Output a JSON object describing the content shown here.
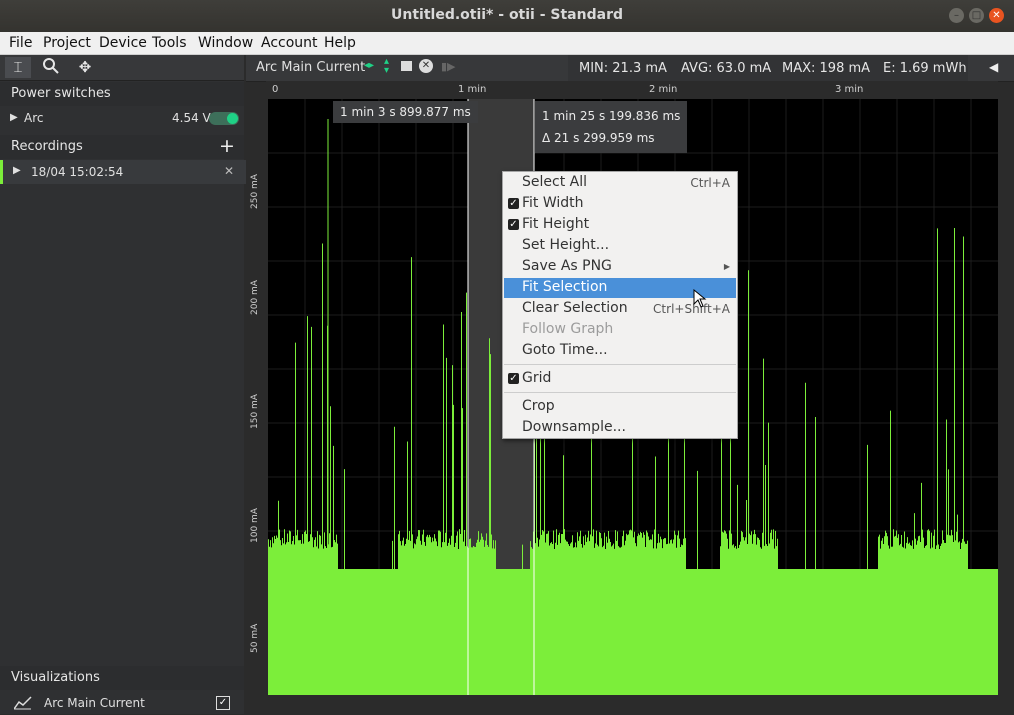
{
  "window": {
    "title": "Untitled.otii* - otii - Standard"
  },
  "menubar": [
    "File",
    "Project",
    "Device",
    "Tools",
    "Window",
    "Account",
    "Help"
  ],
  "sidebar": {
    "power_switches_title": "Power switches",
    "arc_label": "Arc",
    "arc_voltage": "4.54 V",
    "recordings_title": "Recordings",
    "recording_item": "18/04 15:02:54",
    "visualizations_title": "Visualizations",
    "vis_item": "Arc Main Current"
  },
  "plot": {
    "channel": "Arc Main Current",
    "min": "MIN: 21.3 mA",
    "avg": "AVG: 63.0 mA",
    "max": "MAX: 198 mA",
    "energy": "E: 1.69 mWh",
    "time_ticks": [
      "0",
      "1 min",
      "2 min",
      "3 min"
    ],
    "y_ticks": [
      "250 mA",
      "200 mA",
      "150 mA",
      "100 mA",
      "50 mA"
    ],
    "tip_left": "1 min 3 s 899.877 ms",
    "tip_right_line1": "1 min 25 s 199.836 ms",
    "tip_right_line2": "Δ 21 s 299.959 ms"
  },
  "context_menu": {
    "select_all": "Select All",
    "select_all_sc": "Ctrl+A",
    "fit_width": "Fit Width",
    "fit_height": "Fit Height",
    "set_height": "Set Height...",
    "save_png": "Save As PNG",
    "fit_selection": "Fit Selection",
    "clear_selection": "Clear Selection",
    "clear_selection_sc": "Ctrl+Shift+A",
    "follow_graph": "Follow Graph",
    "goto_time": "Goto Time...",
    "grid": "Grid",
    "crop": "Crop",
    "downsample": "Downsample..."
  },
  "colors": {
    "trace": "#7cee3a",
    "accent": "#4a90d9",
    "close": "#e95420",
    "toggle": "#1fd186"
  }
}
